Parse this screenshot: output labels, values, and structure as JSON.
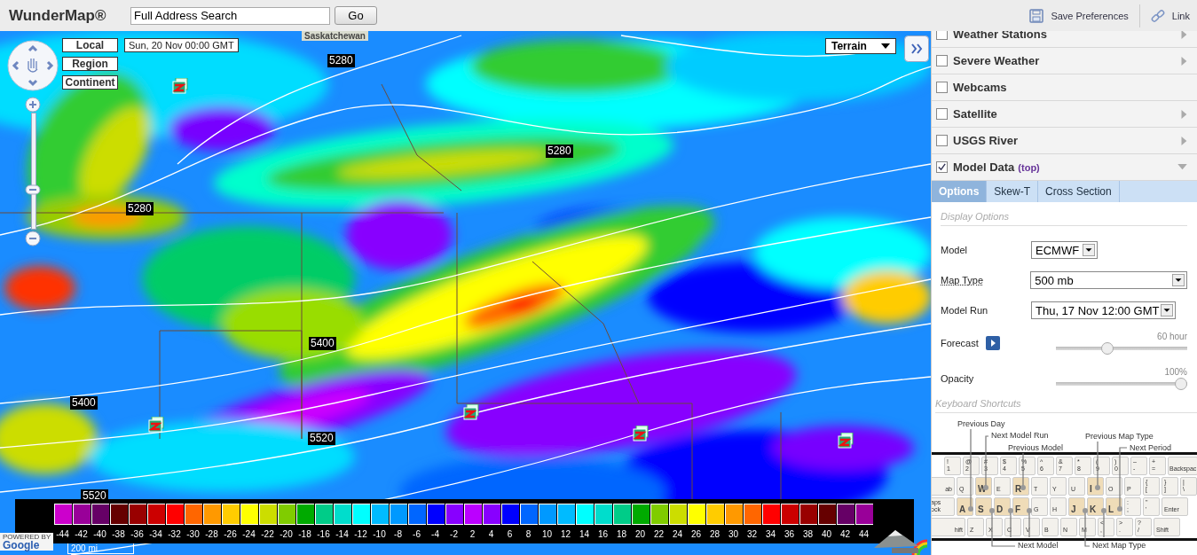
{
  "header": {
    "logo": "WunderMap®",
    "search": {
      "value": "Full Address Search"
    },
    "go_button": "Go",
    "actions": [
      {
        "label": "Save Preferences",
        "kind": "save"
      },
      {
        "label": "Link",
        "kind": "link"
      }
    ]
  },
  "map": {
    "region_label": "Saskatchewan",
    "view_buttons": [
      "Local",
      "Region",
      "Continent"
    ],
    "date": "Sun, 20 Nov 00:00 GMT",
    "map_type_select": "Terrain",
    "contour_labels": [
      "5280",
      "5280",
      "5280",
      "5400",
      "5400",
      "5520",
      "5520"
    ],
    "attribution": "POWERED BY",
    "logo_text": "Google",
    "scale": "200 mi",
    "legend": [
      {
        "label": "-44",
        "color": "#cc00cc"
      },
      {
        "label": "-42",
        "color": "#990099"
      },
      {
        "label": "-40",
        "color": "#660066"
      },
      {
        "label": "-38",
        "color": "#660000"
      },
      {
        "label": "-36",
        "color": "#990000"
      },
      {
        "label": "-34",
        "color": "#cc0000"
      },
      {
        "label": "-32",
        "color": "#ff0000"
      },
      {
        "label": "-30",
        "color": "#ff6600"
      },
      {
        "label": "-28",
        "color": "#ff9900"
      },
      {
        "label": "-26",
        "color": "#ffcc00"
      },
      {
        "label": "-24",
        "color": "#ffff00"
      },
      {
        "label": "-22",
        "color": "#ccdd00"
      },
      {
        "label": "-20",
        "color": "#80cc00"
      },
      {
        "label": "-18",
        "color": "#00aa00"
      },
      {
        "label": "-16",
        "color": "#00cc88"
      },
      {
        "label": "-14",
        "color": "#00ddcc"
      },
      {
        "label": "-12",
        "color": "#00ffff"
      },
      {
        "label": "-10",
        "color": "#00bbff"
      },
      {
        "label": "-8",
        "color": "#0099ff"
      },
      {
        "label": "-6",
        "color": "#0066ff"
      },
      {
        "label": "-4",
        "color": "#0000ff"
      },
      {
        "label": "-2",
        "color": "#8800ff"
      },
      {
        "label": "2",
        "color": "#bb00ff"
      },
      {
        "label": "4",
        "color": "#8800ff"
      },
      {
        "label": "6",
        "color": "#0000ff"
      },
      {
        "label": "8",
        "color": "#0066ff"
      },
      {
        "label": "10",
        "color": "#0099ff"
      },
      {
        "label": "12",
        "color": "#00bbff"
      },
      {
        "label": "14",
        "color": "#00ffff"
      },
      {
        "label": "16",
        "color": "#00ddcc"
      },
      {
        "label": "18",
        "color": "#00cc88"
      },
      {
        "label": "20",
        "color": "#00aa00"
      },
      {
        "label": "22",
        "color": "#80cc00"
      },
      {
        "label": "24",
        "color": "#ccdd00"
      },
      {
        "label": "26",
        "color": "#ffff00"
      },
      {
        "label": "28",
        "color": "#ffcc00"
      },
      {
        "label": "30",
        "color": "#ff9900"
      },
      {
        "label": "32",
        "color": "#ff6600"
      },
      {
        "label": "34",
        "color": "#ff0000"
      },
      {
        "label": "36",
        "color": "#cc0000"
      },
      {
        "label": "38",
        "color": "#990000"
      },
      {
        "label": "40",
        "color": "#660000"
      },
      {
        "label": "42",
        "color": "#660066"
      },
      {
        "label": "44",
        "color": "#990099"
      }
    ]
  },
  "layers": [
    {
      "label": "Weather Stations",
      "checked": false,
      "expanded": false
    },
    {
      "label": "Severe Weather",
      "checked": false,
      "expanded": false
    },
    {
      "label": "Webcams",
      "checked": false
    },
    {
      "label": "Satellite",
      "checked": false,
      "expanded": false
    },
    {
      "label": "USGS River",
      "checked": false,
      "expanded": false
    },
    {
      "label": "Model Data",
      "suffix": "(top)",
      "checked": true,
      "expanded": true
    }
  ],
  "tabs": [
    {
      "label": "Options",
      "selected": true
    },
    {
      "label": "Skew-T",
      "selected": false
    },
    {
      "label": "Cross Section",
      "selected": false
    }
  ],
  "display_options": {
    "title": "Display Options",
    "fields": [
      {
        "label": "Model",
        "value": "ECMWF",
        "help_link": false,
        "kind": "short"
      },
      {
        "label": "Map Type",
        "value": "500 mb",
        "help_link": true,
        "kind": "full"
      },
      {
        "label": "Model Run",
        "value": "Thu, 17 Nov 12:00 GMT",
        "help_link": false,
        "kind": "medium"
      }
    ],
    "sliders": [
      {
        "label": "Forecast",
        "reading": "60 hour",
        "level": 0.38,
        "play_button": true
      },
      {
        "label": "Opacity",
        "reading": "100%",
        "level": 1,
        "play_button": false
      }
    ]
  },
  "keyboard": {
    "title": "Keyboard Shortcuts",
    "callouts": [
      "Previous Day",
      "Next Model Run",
      "Previous Model",
      "Previous Map Type",
      "Next Period",
      "Next Model",
      "Next Map Type"
    ],
    "rows": [
      {
        "keys": [
          {
            "legend": "!",
            "sub": "1",
            "kind": "char",
            "highlighted": false
          },
          {
            "legend": "@",
            "sub": "2",
            "kind": "char",
            "highlighted": false
          },
          {
            "legend": "#",
            "sub": "3",
            "kind": "char",
            "highlighted": false
          },
          {
            "legend": "$",
            "sub": "4",
            "kind": "char",
            "highlighted": false
          },
          {
            "legend": "%",
            "sub": "5",
            "kind": "char",
            "highlighted": false
          },
          {
            "legend": "^",
            "sub": "6",
            "kind": "char",
            "highlighted": false
          },
          {
            "legend": "&",
            "sub": "7",
            "kind": "char",
            "highlighted": false
          },
          {
            "legend": "*",
            "sub": "8",
            "kind": "char",
            "highlighted": false
          },
          {
            "legend": "(",
            "sub": "9",
            "kind": "char",
            "highlighted": false
          },
          {
            "legend": ")",
            "sub": "0",
            "kind": "char",
            "highlighted": false
          },
          {
            "legend": "–",
            "sub": "-",
            "kind": "char",
            "highlighted": false
          },
          {
            "legend": "+",
            "sub": "=",
            "kind": "char",
            "highlighted": false
          },
          {
            "legend": "Backspac",
            "kind": "wide",
            "highlighted": false
          }
        ]
      },
      {
        "keys": [
          {
            "legend": "ab",
            "kind": "wide",
            "highlighted": false
          },
          {
            "legend": "Q",
            "kind": "char",
            "highlighted": false
          },
          {
            "legend": "W",
            "kind": "char",
            "highlighted": true
          },
          {
            "legend": "E",
            "kind": "char",
            "highlighted": false
          },
          {
            "legend": "R",
            "kind": "char",
            "highlighted": true
          },
          {
            "legend": "T",
            "kind": "char",
            "highlighted": false
          },
          {
            "legend": "Y",
            "kind": "char",
            "highlighted": false
          },
          {
            "legend": "U",
            "kind": "char",
            "highlighted": false
          },
          {
            "legend": "I",
            "kind": "char",
            "highlighted": true
          },
          {
            "legend": "O",
            "kind": "char",
            "highlighted": false
          },
          {
            "legend": "P",
            "kind": "char",
            "highlighted": false
          },
          {
            "legend": "{",
            "sub": "[",
            "kind": "char",
            "highlighted": false
          },
          {
            "legend": "}",
            "sub": "]",
            "kind": "char",
            "highlighted": false
          },
          {
            "legend": "|",
            "sub": "\\",
            "kind": "char",
            "highlighted": false
          }
        ]
      },
      {
        "keys": [
          {
            "legend": "aps",
            "sub": "ock",
            "kind": "wide",
            "highlighted": false
          },
          {
            "legend": "A",
            "kind": "char",
            "highlighted": true
          },
          {
            "legend": "S",
            "kind": "char",
            "highlighted": true
          },
          {
            "legend": "D",
            "kind": "char",
            "highlighted": true
          },
          {
            "legend": "F",
            "kind": "char",
            "highlighted": true
          },
          {
            "legend": "G",
            "kind": "char",
            "highlighted": false
          },
          {
            "legend": "H",
            "kind": "char",
            "highlighted": false
          },
          {
            "legend": "J",
            "kind": "char",
            "highlighted": true
          },
          {
            "legend": "K",
            "kind": "char",
            "highlighted": true
          },
          {
            "legend": "L",
            "kind": "char",
            "highlighted": true
          },
          {
            "legend": ":",
            "sub": ";",
            "kind": "char",
            "highlighted": false
          },
          {
            "legend": "\"",
            "sub": "'",
            "kind": "char",
            "highlighted": false
          },
          {
            "legend": "Enter",
            "kind": "wide",
            "highlighted": false
          }
        ]
      },
      {
        "keys": [
          {
            "legend": "hift",
            "kind": "wide",
            "highlighted": false
          },
          {
            "legend": "Z",
            "kind": "char",
            "highlighted": false
          },
          {
            "legend": "X",
            "kind": "char",
            "highlighted": false
          },
          {
            "legend": "C",
            "kind": "char",
            "highlighted": false
          },
          {
            "legend": "V",
            "kind": "char",
            "highlighted": false
          },
          {
            "legend": "B",
            "kind": "char",
            "highlighted": false
          },
          {
            "legend": "N",
            "kind": "char",
            "highlighted": false
          },
          {
            "legend": "M",
            "kind": "char",
            "highlighted": false
          },
          {
            "legend": "<",
            "sub": ",",
            "kind": "char",
            "highlighted": false
          },
          {
            "legend": ">",
            "sub": ".",
            "kind": "char",
            "highlighted": false
          },
          {
            "legend": "?",
            "sub": "/",
            "kind": "char",
            "highlighted": false
          },
          {
            "legend": "Shift",
            "kind": "wide",
            "highlighted": false
          }
        ]
      }
    ]
  }
}
